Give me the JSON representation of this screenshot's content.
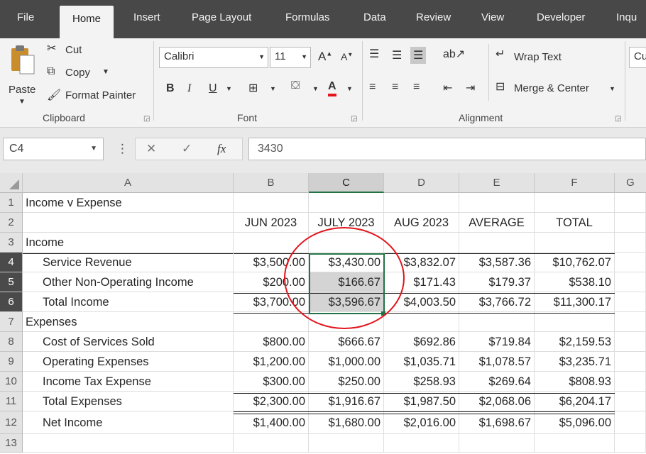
{
  "ribbon_tabs": [
    "File",
    "Home",
    "Insert",
    "Page Layout",
    "Formulas",
    "Data",
    "Review",
    "View",
    "Developer",
    "Inqu"
  ],
  "ribbon": {
    "clipboard": {
      "paste": "Paste",
      "cut": "Cut",
      "copy": "Copy",
      "format_painter": "Format Painter",
      "label": "Clipboard"
    },
    "font": {
      "name": "Calibri",
      "size": "11",
      "bold": "B",
      "italic": "I",
      "underline": "U",
      "label": "Font",
      "font_color": "#e2141c"
    },
    "alignment": {
      "wrap_text": "Wrap Text",
      "merge_center": "Merge & Center",
      "label": "Alignment"
    },
    "number_format_partial": "Cu"
  },
  "formula_bar": {
    "name_box": "C4",
    "value": "3430",
    "cancel_icon": "close-icon",
    "enter_icon": "check-icon",
    "fx": "fx"
  },
  "columns": [
    "A",
    "B",
    "C",
    "D",
    "E",
    "F",
    "G"
  ],
  "selected_column": "C",
  "selected_cell": "C4",
  "rows": [
    {
      "n": "1",
      "a": "Income v Expense",
      "b": "",
      "c": "",
      "d": "",
      "e": "",
      "f": ""
    },
    {
      "n": "2",
      "a": "",
      "b": "JUN 2023",
      "c": "JULY 2023",
      "d": "AUG 2023",
      "e": "AVERAGE",
      "f": "TOTAL"
    },
    {
      "n": "3",
      "a": "Income",
      "b": "",
      "c": "",
      "d": "",
      "e": "",
      "f": ""
    },
    {
      "n": "4",
      "a": "Service Revenue",
      "b": "$3,500.00",
      "c": "$3,430.00",
      "d": "$3,832.07",
      "e": "$3,587.36",
      "f": "$10,762.07"
    },
    {
      "n": "5",
      "a": "Other Non-Operating Income",
      "b": "$200.00",
      "c": "$166.67",
      "d": "$171.43",
      "e": "$179.37",
      "f": "$538.10"
    },
    {
      "n": "6",
      "a": "Total Income",
      "b": "$3,700.00",
      "c": "$3,596.67",
      "d": "$4,003.50",
      "e": "$3,766.72",
      "f": "$11,300.17"
    },
    {
      "n": "7",
      "a": "Expenses",
      "b": "",
      "c": "",
      "d": "",
      "e": "",
      "f": ""
    },
    {
      "n": "8",
      "a": "Cost of Services Sold",
      "b": "$800.00",
      "c": "$666.67",
      "d": "$692.86",
      "e": "$719.84",
      "f": "$2,159.53"
    },
    {
      "n": "9",
      "a": "Operating Expenses",
      "b": "$1,200.00",
      "c": "$1,000.00",
      "d": "$1,035.71",
      "e": "$1,078.57",
      "f": "$3,235.71"
    },
    {
      "n": "10",
      "a": "Income Tax Expense",
      "b": "$300.00",
      "c": "$250.00",
      "d": "$258.93",
      "e": "$269.64",
      "f": "$808.93"
    },
    {
      "n": "11",
      "a": "Total Expenses",
      "b": "$2,300.00",
      "c": "$1,916.67",
      "d": "$1,987.50",
      "e": "$2,068.06",
      "f": "$6,204.17"
    },
    {
      "n": "12",
      "a": "Net Income",
      "b": "$1,400.00",
      "c": "$1,680.00",
      "d": "$2,016.00",
      "e": "$1,698.67",
      "f": "$5,096.00"
    },
    {
      "n": "13",
      "a": "",
      "b": "",
      "c": "",
      "d": "",
      "e": "",
      "f": ""
    }
  ],
  "colors": {
    "selection": "#217346",
    "annotation": "#e2141c",
    "highlight": "#d4d4d4"
  }
}
